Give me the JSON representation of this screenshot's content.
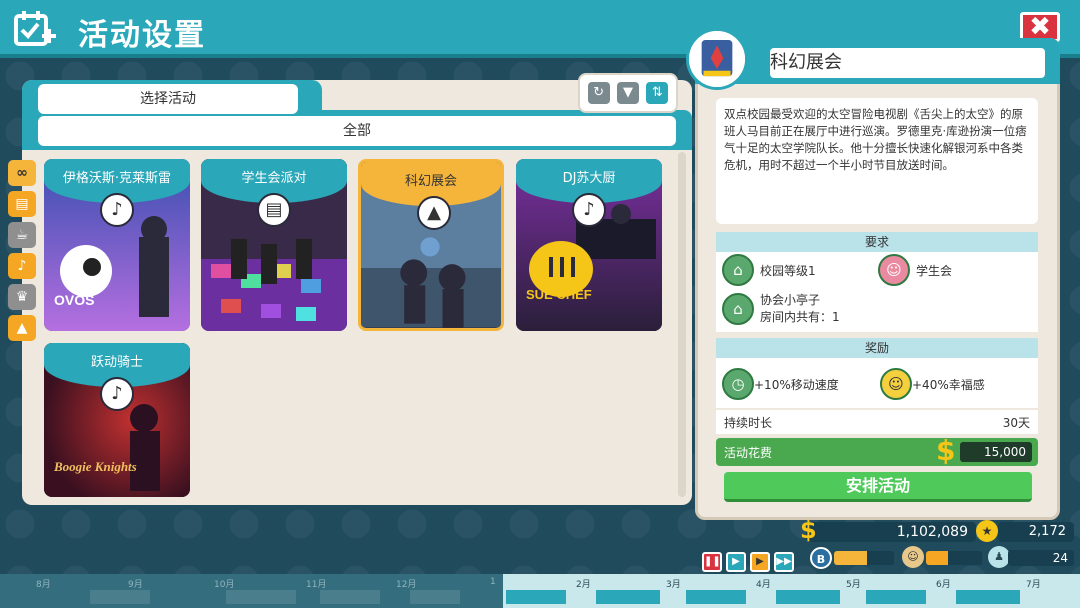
{
  "header": {
    "title": "活动设置",
    "close_label": "✖"
  },
  "left_panel": {
    "tab_label": "选择活动",
    "filter_label": "全部",
    "categories": [
      {
        "name": "infinity-icon",
        "glyph": "∞"
      },
      {
        "name": "boombox-icon",
        "glyph": "▤"
      },
      {
        "name": "teapot-icon",
        "glyph": "☕"
      },
      {
        "name": "microphone-icon",
        "glyph": "🎤"
      },
      {
        "name": "trophy-icon",
        "glyph": "🏆"
      },
      {
        "name": "rocket-icon",
        "glyph": "🚀"
      }
    ],
    "activities": [
      {
        "title": "伊格沃斯·克莱斯雷",
        "icon": "microphone-icon"
      },
      {
        "title": "学生会派对",
        "icon": "boombox-icon"
      },
      {
        "title": "科幻展会",
        "icon": "rocket-icon"
      },
      {
        "title": "DJ苏大厨",
        "icon": "microphone-icon"
      },
      {
        "title": "跃动骑士",
        "icon": "microphone-icon"
      }
    ],
    "card_art_text": {
      "ovos": "OVOS",
      "sue_chef": "SUE CHEF",
      "boogie_knights": "Boogie Knights"
    }
  },
  "detail": {
    "title": "科幻展会",
    "description": "双点校园最受欢迎的太空冒险电视剧《舌尖上的太空》的原班人马目前正在展厅中进行巡演。罗德里克·库逊扮演一位痞气十足的太空学院队长。他十分擅长快速化解银河系中各类危机，用时不超过一个半小时节目放送时间。",
    "requirements_label": "要求",
    "requirements": [
      {
        "label": "校园等级1",
        "icon": "campus-icon"
      },
      {
        "label": "学生会",
        "icon": "student-union-icon"
      },
      {
        "label": "协会小亭子",
        "sub": "房间内共有：1",
        "icon": "kiosk-icon"
      }
    ],
    "rewards_label": "奖励",
    "rewards": [
      {
        "label": "+10%移动速度",
        "icon": "speed-icon"
      },
      {
        "label": "+40%幸福感",
        "icon": "happy-icon"
      }
    ],
    "duration_label": "持续时长",
    "duration_value": "30天",
    "cost_label": "活动花费",
    "cost_value": "15,000",
    "schedule_button": "安排活动"
  },
  "hud": {
    "money": "1,102,089",
    "kudos": "2,172",
    "students": "24",
    "grade_letter": "B",
    "grade_progress": 0.55,
    "happiness_progress": 0.4
  },
  "timeline": {
    "past_months": [
      "8月",
      "9月",
      "10月",
      "11月",
      "12月",
      "1"
    ],
    "future_months": [
      "2月",
      "3月",
      "4月",
      "5月",
      "6月",
      "7月"
    ]
  },
  "colors": {
    "accent": "#2aa7b8",
    "selected": "#f5b53a",
    "cost_green": "#4aa84e",
    "close_red": "#d9333f"
  }
}
